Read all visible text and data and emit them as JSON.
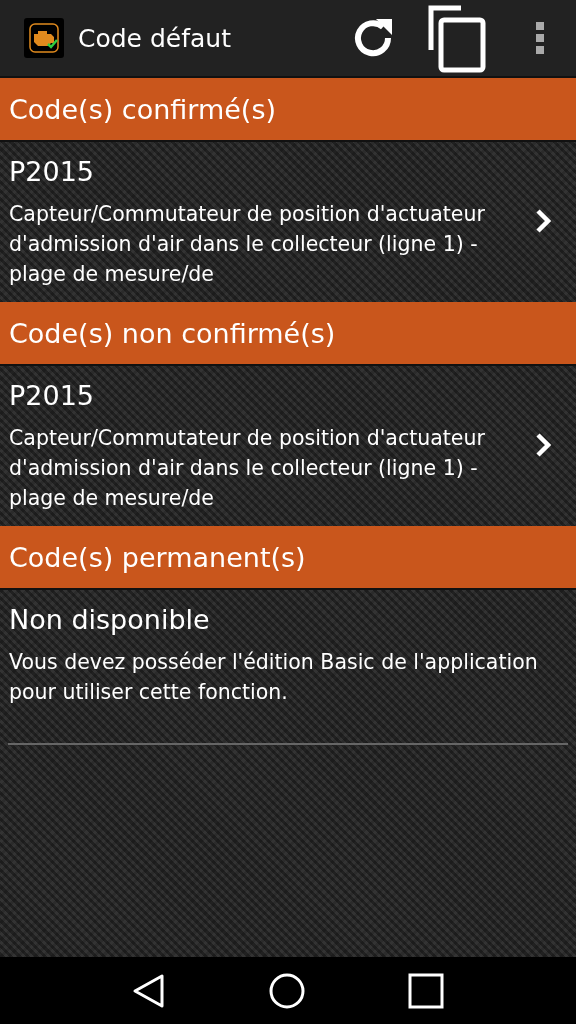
{
  "app_bar": {
    "title": "Code défaut"
  },
  "sections": [
    {
      "heading": "Code(s) confirmé(s)",
      "kind": "codes",
      "items": [
        {
          "code": "P2015",
          "description": "Capteur/Commutateur de position d'actuateur d'admission d'air dans le collecteur (ligne 1) - plage de mesure/de"
        }
      ]
    },
    {
      "heading": "Code(s) non confirmé(s)",
      "kind": "codes",
      "items": [
        {
          "code": "P2015",
          "description": "Capteur/Commutateur de position d'actuateur d'admission d'air dans le collecteur (ligne 1) - plage de mesure/de"
        }
      ]
    },
    {
      "heading": "Code(s) permanent(s)",
      "kind": "message",
      "title": "Non disponible",
      "text": "Vous devez posséder l'édition Basic de l'application pour utiliser cette fonction."
    }
  ]
}
